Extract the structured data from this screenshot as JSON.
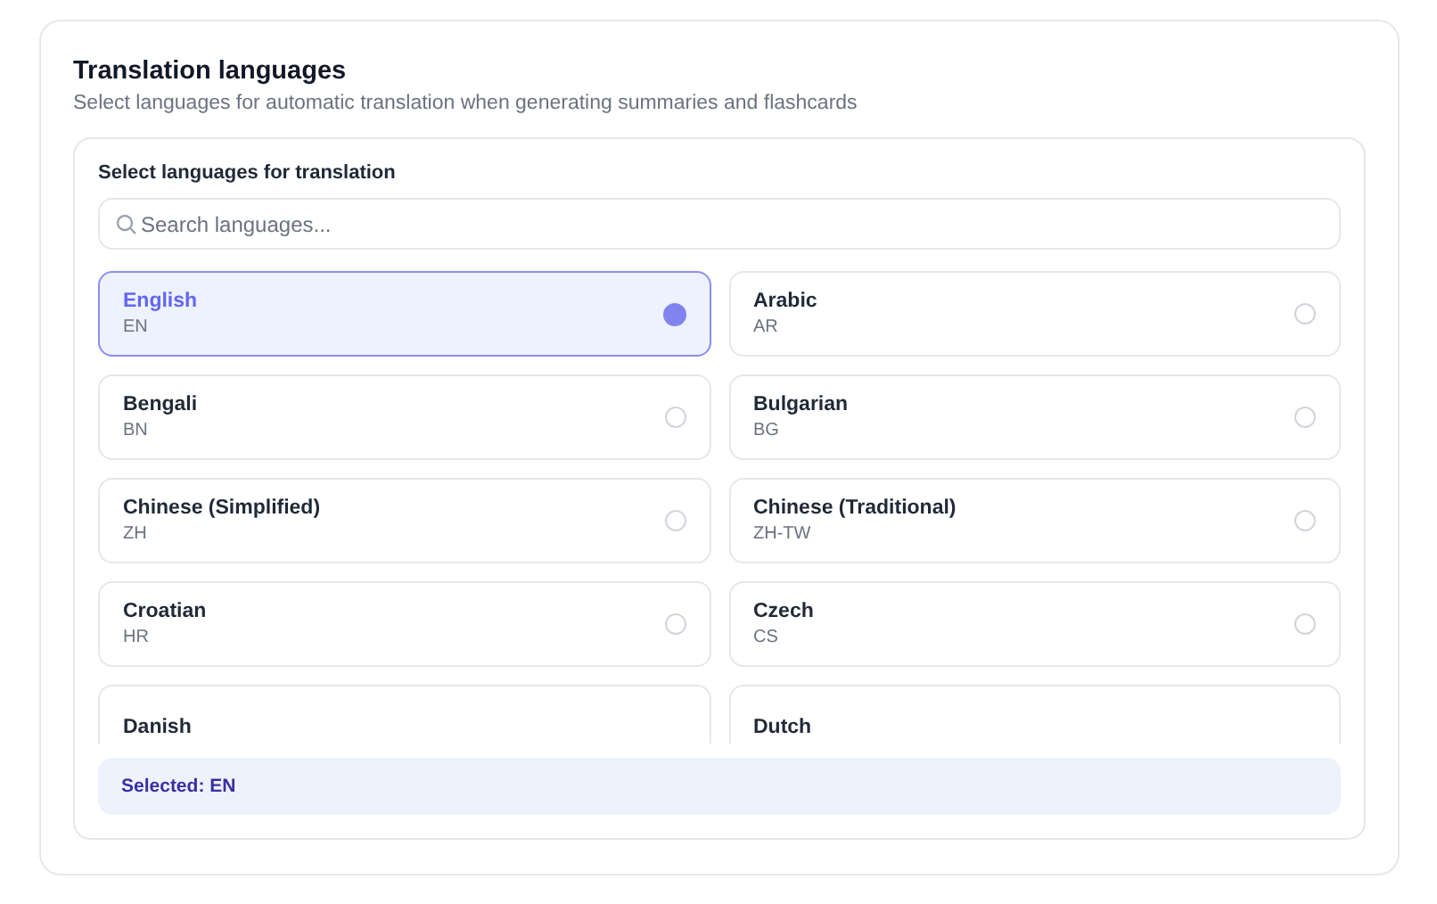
{
  "header": {
    "title": "Translation languages",
    "subtitle": "Select languages for automatic translation when generating summaries and flashcards"
  },
  "picker": {
    "label": "Select languages for translation",
    "search": {
      "placeholder": "Search languages..."
    },
    "languages": [
      {
        "name": "English",
        "code": "EN",
        "selected": true
      },
      {
        "name": "Arabic",
        "code": "AR",
        "selected": false
      },
      {
        "name": "Bengali",
        "code": "BN",
        "selected": false
      },
      {
        "name": "Bulgarian",
        "code": "BG",
        "selected": false
      },
      {
        "name": "Chinese (Simplified)",
        "code": "ZH",
        "selected": false
      },
      {
        "name": "Chinese (Traditional)",
        "code": "ZH-TW",
        "selected": false
      },
      {
        "name": "Croatian",
        "code": "HR",
        "selected": false
      },
      {
        "name": "Czech",
        "code": "CS",
        "selected": false
      },
      {
        "name": "Danish",
        "selected": false
      },
      {
        "name": "Dutch",
        "selected": false
      }
    ],
    "summary": "Selected: EN"
  }
}
